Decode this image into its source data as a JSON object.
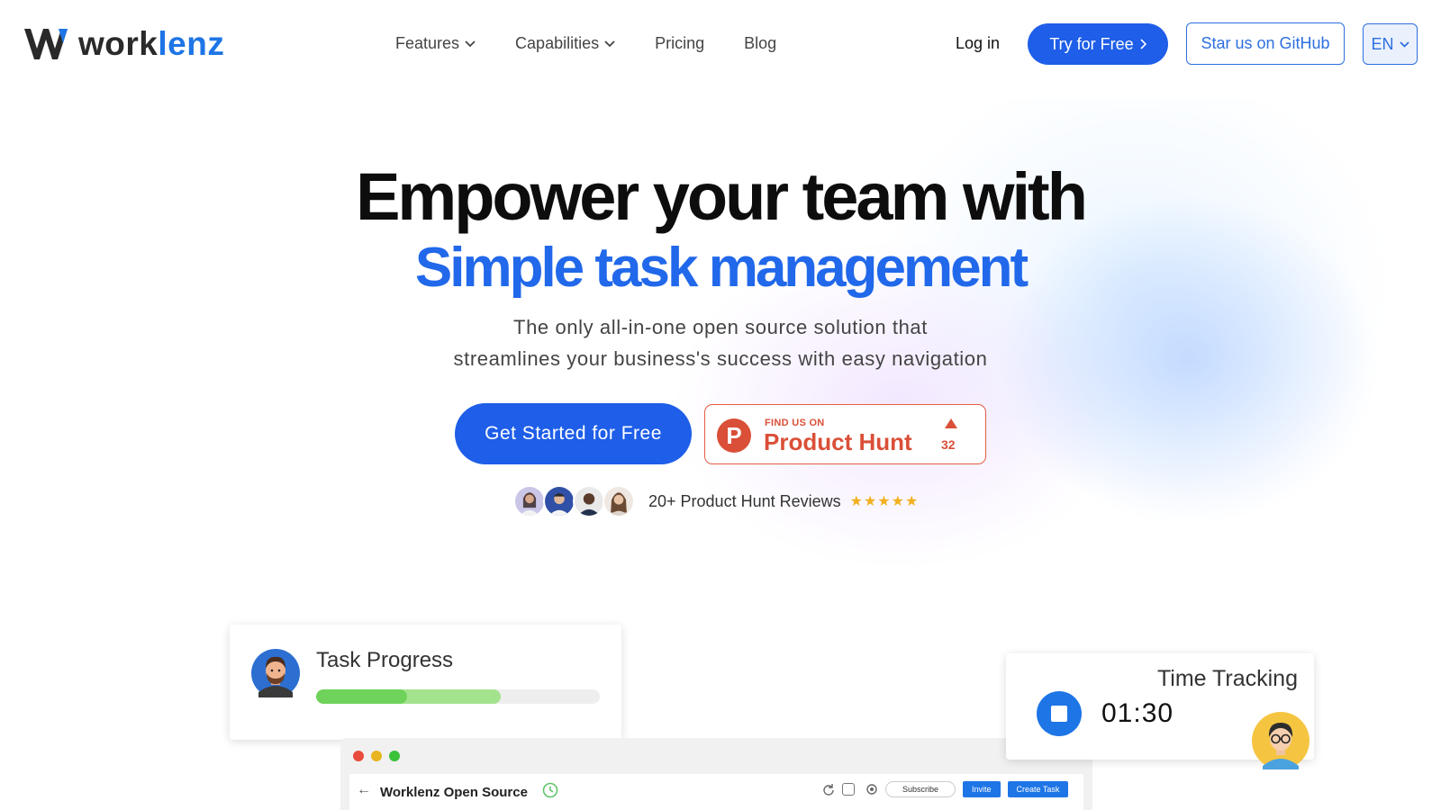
{
  "brand": {
    "name_part1": "work",
    "name_part2": "lenz",
    "accent": "#1e75e6"
  },
  "nav": {
    "items": [
      {
        "label": "Features",
        "has_dropdown": true
      },
      {
        "label": "Capabilities",
        "has_dropdown": true
      },
      {
        "label": "Pricing",
        "has_dropdown": false
      },
      {
        "label": "Blog",
        "has_dropdown": false
      }
    ],
    "login": "Log in",
    "try_free": "Try for Free",
    "github": "Star us on GitHub",
    "language": "EN"
  },
  "hero": {
    "headline": "Empower your team with",
    "headline_accent": "Simple task management",
    "subtitle_line1": "The only all-in-one open source solution that",
    "subtitle_line2": "streamlines your business's success with easy navigation",
    "cta": "Get Started for Free",
    "product_hunt": {
      "small": "FIND US ON",
      "big": "Product Hunt",
      "votes": "32",
      "color": "#da4f37"
    },
    "reviews_text": "20+ Product Hunt Reviews",
    "rating_stars": "★★★★★"
  },
  "task_card": {
    "title": "Task Progress",
    "progress_primary": 0.32,
    "progress_secondary": 0.65
  },
  "app_preview": {
    "back": "←",
    "title": "Worklenz Open Source",
    "subscribe": "Subscribe",
    "invite": "Invite",
    "create_task": "Create Task",
    "window_dots": [
      "#e94b3c",
      "#e8b51f",
      "#3cc13b"
    ]
  },
  "time_card": {
    "title": "Time Tracking",
    "time": "01:30"
  }
}
